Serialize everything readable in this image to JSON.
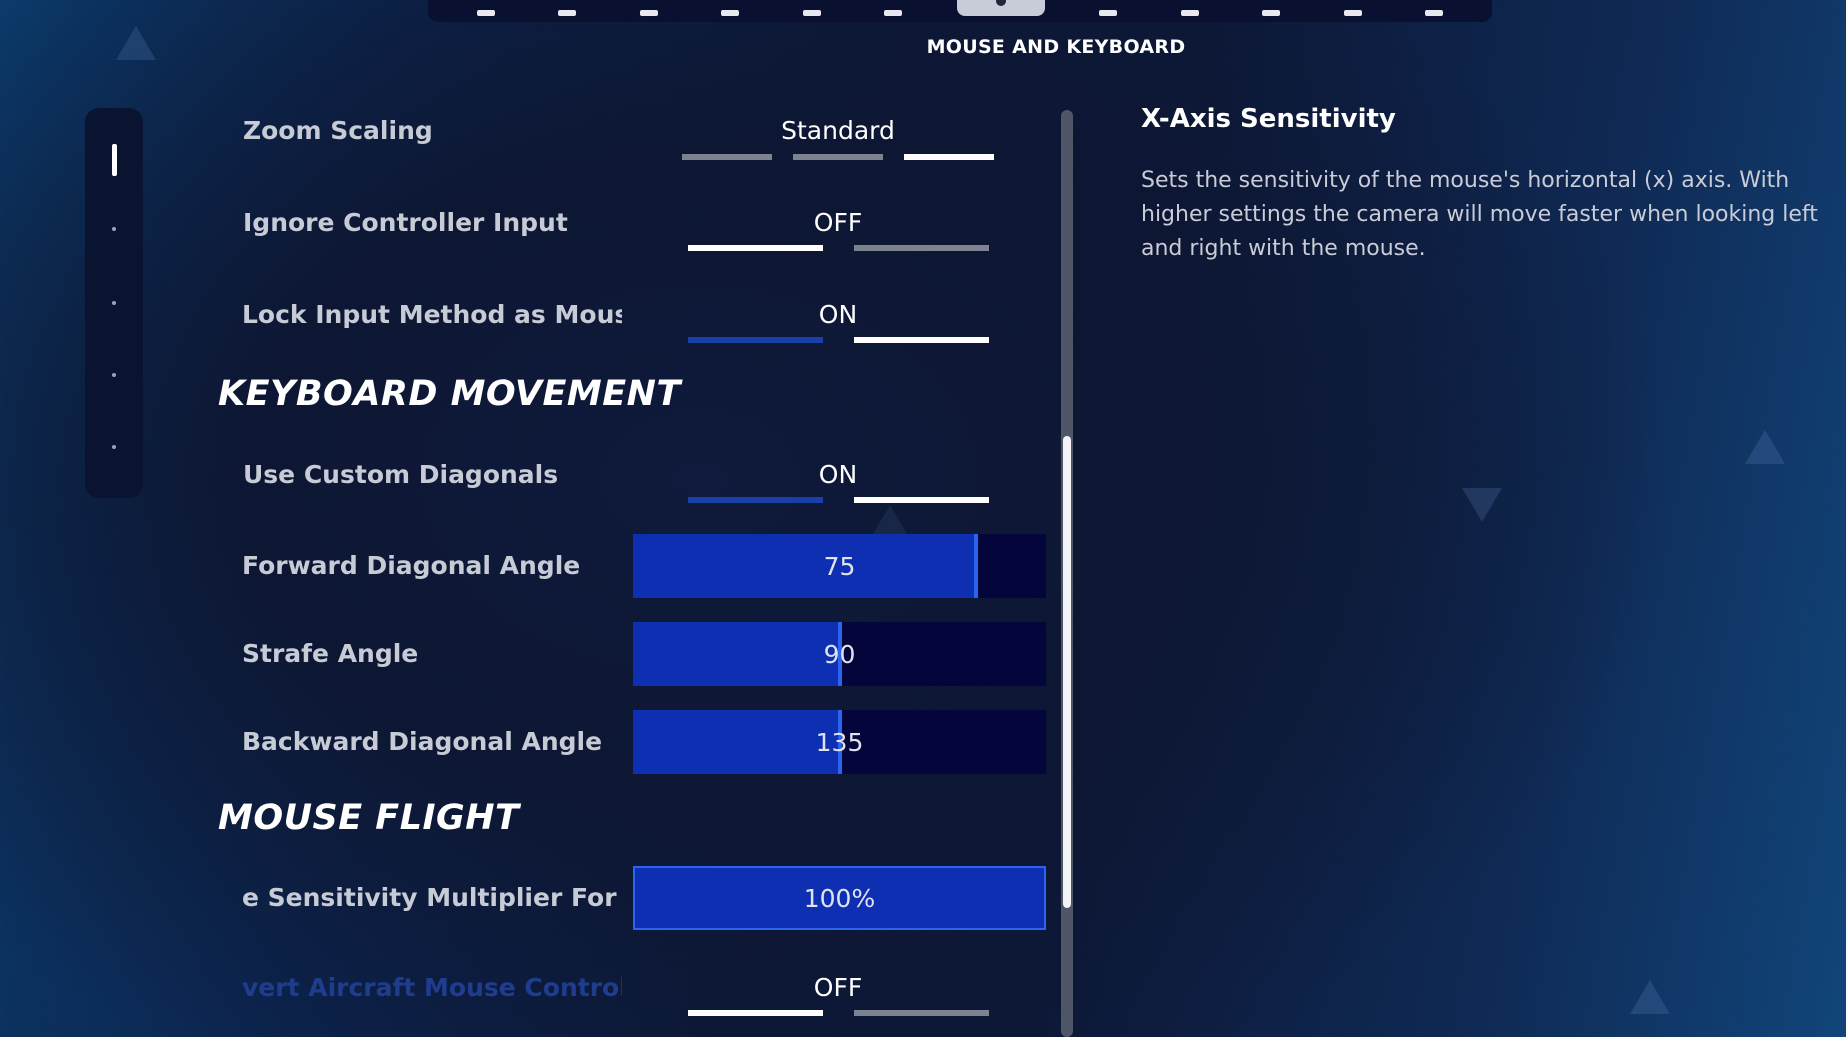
{
  "top_nav": {
    "icons": [
      "user-icon",
      "brightness-icon",
      "grid-icon",
      "controller-icon",
      "display-icon",
      "mouse-icon",
      "keyboard-icon",
      "gamepad-icon",
      "network-icon",
      "accessibility-icon",
      "account-icon",
      "settings-icon"
    ],
    "active_index": 6
  },
  "page": {
    "heading": "MOUSE AND KEYBOARD"
  },
  "settings": {
    "zoom_scaling": {
      "label": "Zoom Scaling",
      "value": "Standard"
    },
    "ignore_controller_input": {
      "label": "Ignore Controller Input",
      "value": "OFF"
    },
    "lock_input_method": {
      "label": "Lock Input Method as Mouse",
      "value": "ON"
    },
    "keyboard_movement_title": "KEYBOARD MOVEMENT",
    "use_custom_diagonals": {
      "label": "Use Custom Diagonals",
      "value": "ON"
    },
    "forward_diagonal_angle": {
      "label": "Forward Diagonal Angle",
      "value": "75",
      "fill": 0.83
    },
    "strafe_angle": {
      "label": "Strafe Angle",
      "value": "90",
      "fill": 0.5
    },
    "backward_diagonal_angle": {
      "label": "Backward Diagonal Angle",
      "value": "135",
      "fill": 0.5
    },
    "mouse_flight_title": "MOUSE FLIGHT",
    "sensitivity_multiplier": {
      "label": "e Sensitivity Multiplier For Ai",
      "value": "100%",
      "fill": 1.0
    },
    "invert_aircraft": {
      "label": "vert Aircraft Mouse Controls",
      "value": "OFF"
    }
  },
  "description": {
    "title": "X-Axis Sensitivity",
    "body": "Sets the sensitivity of the mouse's horizontal (x) axis. With higher settings the camera will move faster when looking left and right with the mouse."
  }
}
